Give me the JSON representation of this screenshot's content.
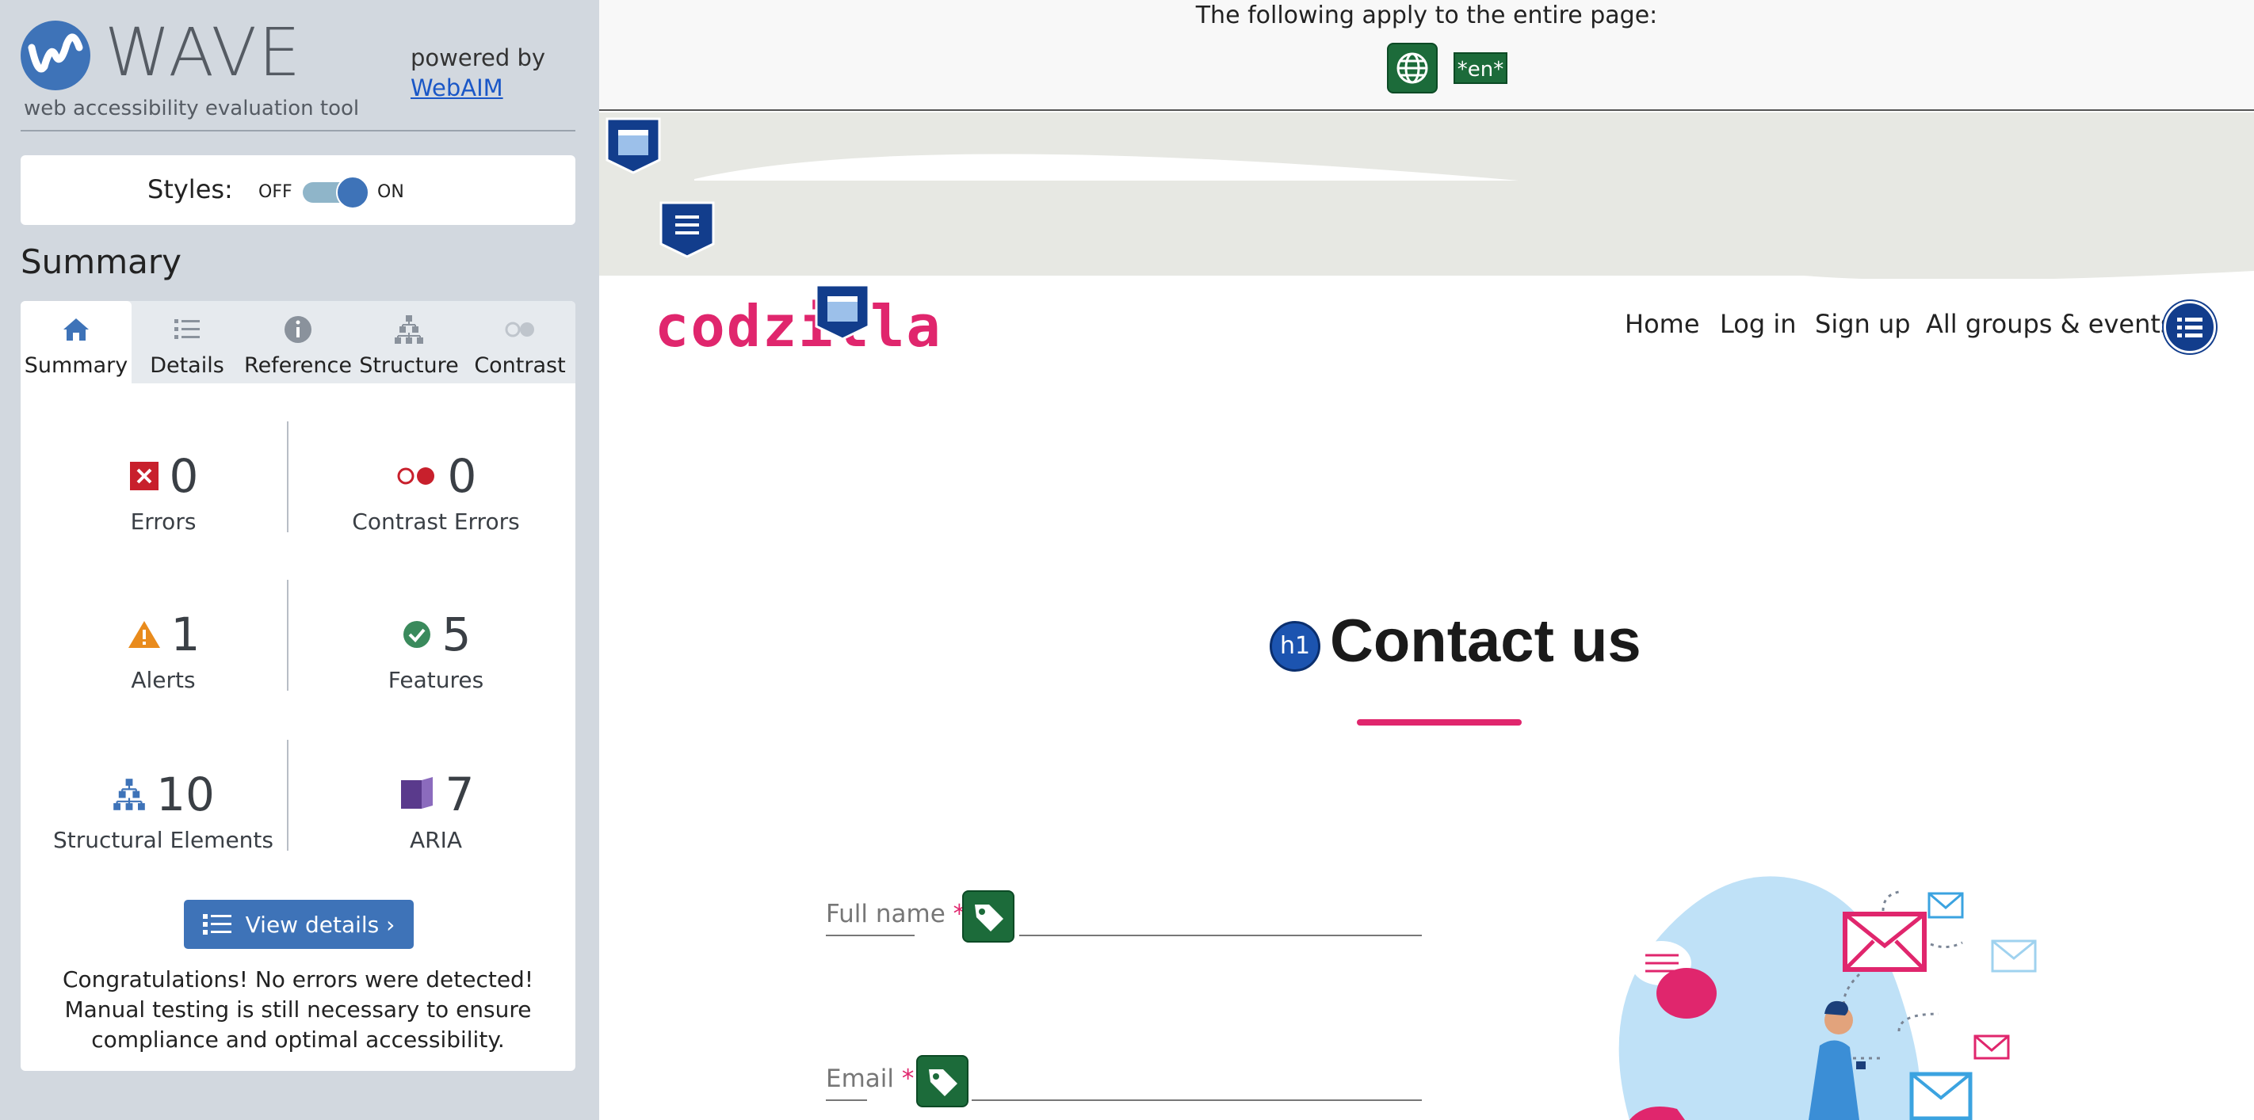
{
  "wave": {
    "title": "WAVE",
    "subtitle": "web accessibility evaluation tool",
    "powered_by": "powered by",
    "webaim_link": "WebAIM",
    "styles_label": "Styles:",
    "styles_off": "OFF",
    "styles_on": "ON",
    "summary_heading": "Summary",
    "tabs": [
      {
        "label": "Summary",
        "icon": "home-icon"
      },
      {
        "label": "Details",
        "icon": "list-icon"
      },
      {
        "label": "Reference",
        "icon": "info-icon"
      },
      {
        "label": "Structure",
        "icon": "hierarchy-icon"
      },
      {
        "label": "Contrast",
        "icon": "contrast-icon"
      }
    ],
    "stats": {
      "errors": {
        "count": "0",
        "label": "Errors"
      },
      "contrast_errors": {
        "count": "0",
        "label": "Contrast Errors"
      },
      "alerts": {
        "count": "1",
        "label": "Alerts"
      },
      "features": {
        "count": "5",
        "label": "Features"
      },
      "structural": {
        "count": "10",
        "label": "Structural Elements"
      },
      "aria": {
        "count": "7",
        "label": "ARIA"
      }
    },
    "view_details": "View details ›",
    "congrats": "Congratulations! No errors were detected! Manual testing is still necessary to ensure compliance and optimal accessibility.",
    "colors": {
      "accent": "#3e73b8",
      "error": "#c8202c",
      "alert": "#e98b1c",
      "feature": "#3a8a5c",
      "aria": "#5a3a8c"
    }
  },
  "page": {
    "top_notice": "The following apply to the entire page:",
    "lang_badge": "*en*",
    "brand": "codzilla",
    "nav": [
      "Home",
      "Log in",
      "Sign up",
      "All groups & events"
    ],
    "h1_badge": "h1",
    "heading": "Contact us",
    "fields": [
      {
        "label": "Full name",
        "required": "*"
      },
      {
        "label": "Email",
        "required": "*"
      }
    ],
    "colors": {
      "brand_pink": "#e0266d",
      "feature_green": "#1c6b3a",
      "structure_navy": "#123d8c"
    }
  }
}
